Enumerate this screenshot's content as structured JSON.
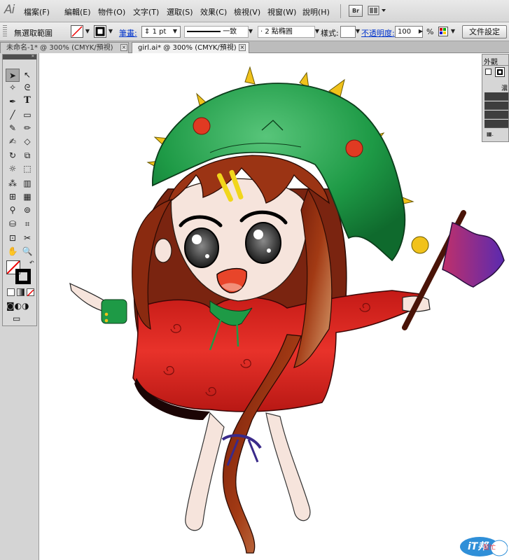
{
  "app": {
    "logo": "Ai"
  },
  "menubar": {
    "items": [
      "檔案(F)",
      "編輯(E)",
      "物件(O)",
      "文字(T)",
      "選取(S)",
      "效果(C)",
      "檢視(V)",
      "視窗(W)",
      "說明(H)"
    ],
    "bridge_label": "Br"
  },
  "controlbar": {
    "selection_label": "無選取範圍",
    "stroke_label": "筆畫:",
    "stroke_weight": "1 pt",
    "stroke_profile": "一致",
    "brush": "2 點橢圓",
    "style_label": "樣式:",
    "opacity_label": "不透明度:",
    "opacity_value": "100",
    "opacity_unit": "%",
    "doc_setup_label": "文件設定",
    "fill_color": "#ffffff",
    "stroke_color": "#000000"
  },
  "tabs": [
    {
      "label": "未命名-1* @ 300% (CMYK/預視)",
      "active": false
    },
    {
      "label": "girl.ai* @ 300% (CMYK/預視)",
      "active": true
    }
  ],
  "appearance_panel": {
    "title": "外觀",
    "opacity_label": "濃"
  },
  "tools": [
    "selection-tool",
    "direct-selection-tool",
    "magic-wand-tool",
    "lasso-tool",
    "pen-tool",
    "type-tool",
    "line-segment-tool",
    "rectangle-tool",
    "paintbrush-tool",
    "pencil-tool",
    "blob-brush-tool",
    "eraser-tool",
    "rotate-tool",
    "scale-tool",
    "warp-tool",
    "free-transform-tool",
    "symbol-sprayer-tool",
    "column-graph-tool",
    "mesh-tool",
    "gradient-tool",
    "eyedropper-tool",
    "blend-tool",
    "live-paint-bucket-tool",
    "live-paint-selection-tool",
    "artboard-tool",
    "slice-tool",
    "hand-tool",
    "zoom-tool"
  ],
  "watermark": {
    "text": "iT邦",
    "sub": "幫忙"
  },
  "colors": {
    "hood_green": "#1e9a46",
    "hair_brown": "#8a2a10",
    "dress_red": "#e0241f",
    "flag_purple": "#7a2b9a",
    "skin": "#f6e4dc"
  }
}
